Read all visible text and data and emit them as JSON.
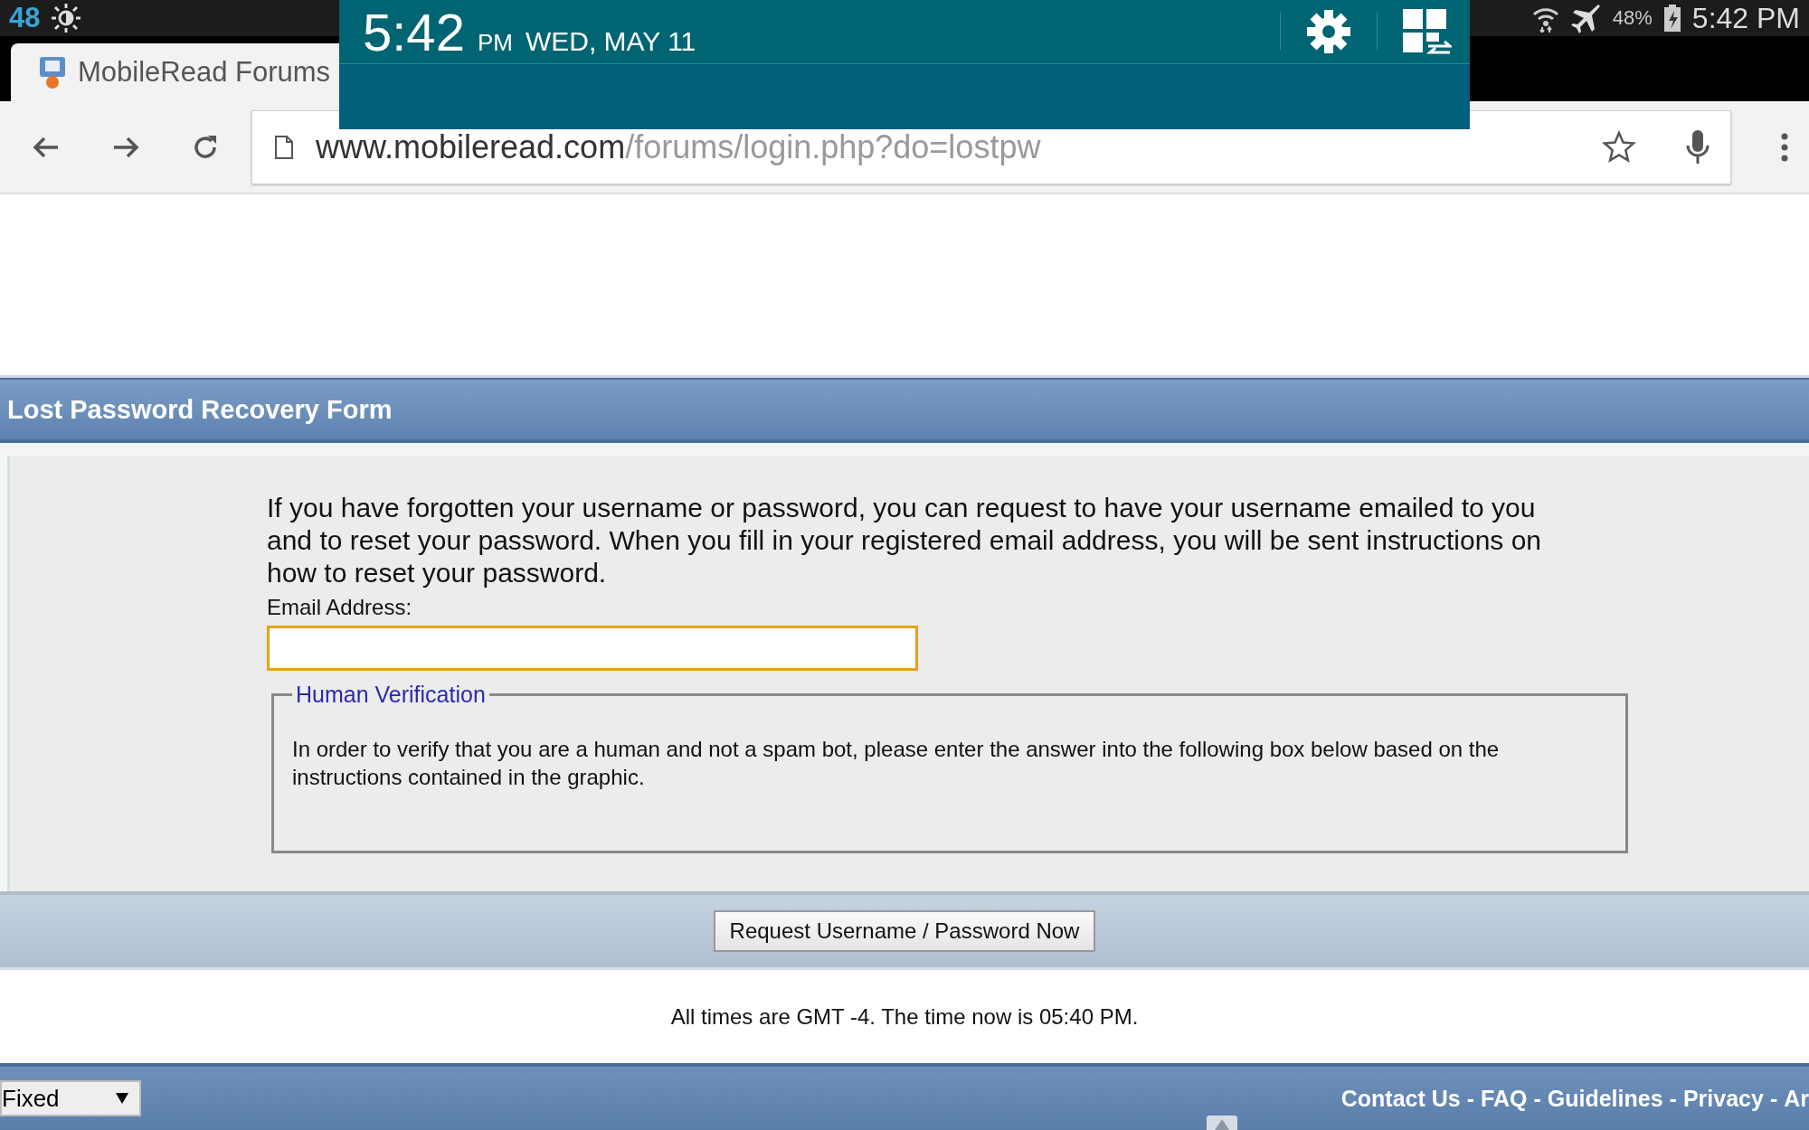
{
  "status_bar": {
    "notification_count": "48",
    "battery": "48%",
    "time": "5:42 PM"
  },
  "notification_panel": {
    "time": "5:42",
    "ampm": "PM",
    "date": "WED, MAY 11"
  },
  "browser": {
    "tab": {
      "title": "MobileRead Forums",
      "selected": true
    },
    "url": {
      "host": "www.mobileread.com",
      "path": "/forums/login.php?do=lostpw"
    }
  },
  "form": {
    "title": "Lost Password Recovery Form",
    "intro": "If you have forgotten your username or password, you can request to have your username emailed to you and to reset your password. When you fill in your registered email address, you will be sent instructions on how to reset your password.",
    "email_label": "Email Address:",
    "email_focused": true,
    "verification": {
      "legend": "Human Verification",
      "text": "In order to verify that you are a human and not a spam bot, please enter the answer into the following box below based on the instructions contained in the graphic."
    },
    "submit": "Request Username / Password Now"
  },
  "time_note": "All times are GMT -4. The time now is 05:40 PM.",
  "footer": {
    "style_select": "Fixed",
    "links": [
      {
        "label": "Contact Us",
        "separator": "-"
      },
      {
        "label": "FAQ",
        "separator": "-"
      },
      {
        "label": "Guidelines",
        "separator": "-"
      },
      {
        "label": "Privacy",
        "separator": "-"
      },
      {
        "label": "Ar"
      }
    ]
  }
}
